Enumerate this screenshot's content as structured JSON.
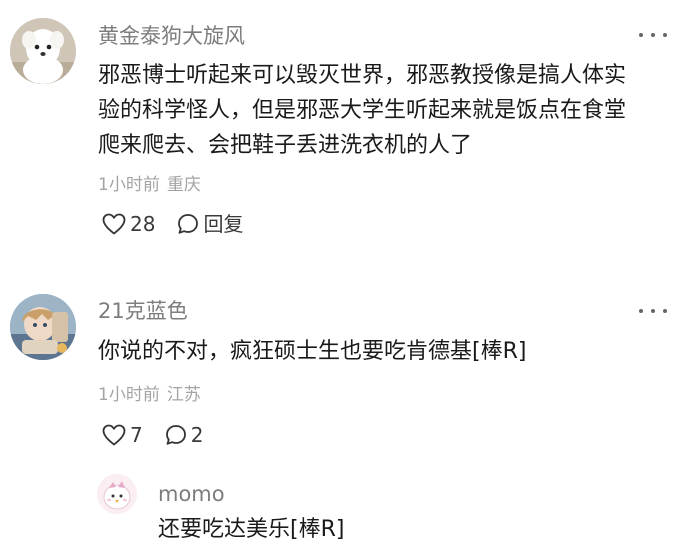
{
  "comments": [
    {
      "username": "黄金泰狗大旋风",
      "lines": [
        "邪恶博士听起来可以毁灭世界，邪恶教授像是搞人体实",
        "验的科学怪人，但是邪恶大学生听起来就是饭点在食堂",
        "爬来爬去、会把鞋子丢进洗衣机的人了"
      ],
      "time": "1小时前",
      "location": "重庆",
      "likes": "28",
      "reply_label": "回复",
      "avatar_icon": "white-dog-avatar"
    },
    {
      "username": "21克蓝色",
      "lines": [
        "你说的不对，疯狂硕士生也要吃肯德基[棒R]"
      ],
      "time": "1小时前",
      "location": "江苏",
      "likes": "7",
      "replies": "2",
      "avatar_icon": "anime-character-avatar"
    }
  ],
  "reply": {
    "username": "momo",
    "text": "还要吃达美乐[棒R]",
    "avatar_icon": "cartoon-bird-avatar"
  },
  "colors": {
    "username": "#7d7d7d",
    "body_text": "#1a1a1a",
    "meta_text": "#a4a4a4"
  }
}
